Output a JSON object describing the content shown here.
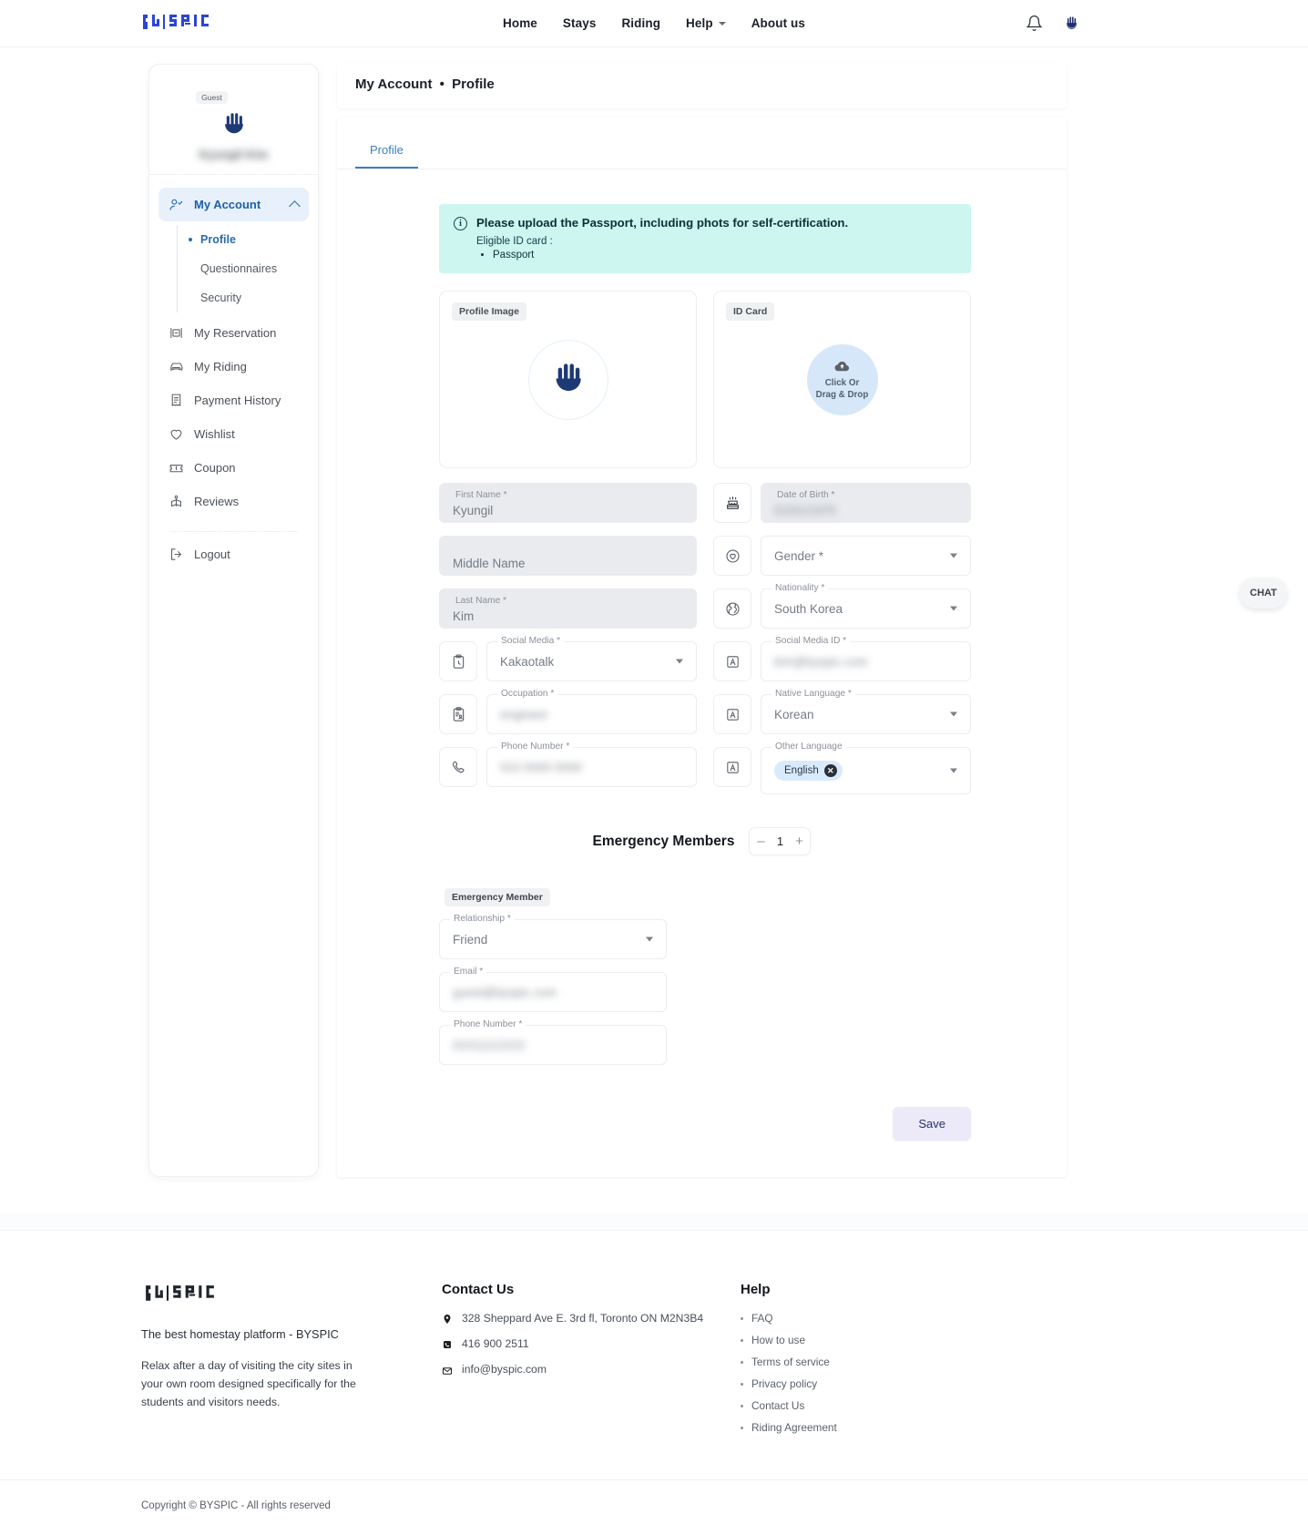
{
  "header": {
    "logo_text": "BYSPIC",
    "nav": [
      {
        "label": "Home",
        "has_caret": false
      },
      {
        "label": "Stays",
        "has_caret": false
      },
      {
        "label": "Riding",
        "has_caret": false
      },
      {
        "label": "Help",
        "has_caret": true
      },
      {
        "label": "About us",
        "has_caret": false
      }
    ],
    "bell_icon": "bell-icon",
    "user_icon": "user-hand-icon"
  },
  "sidebar": {
    "badge": "Guest",
    "user_name": "Kyungil Kim",
    "account": {
      "label": "My Account",
      "expanded": true,
      "children": [
        {
          "label": "Profile",
          "active": true
        },
        {
          "label": "Questionnaires",
          "active": false
        },
        {
          "label": "Security",
          "active": false
        }
      ]
    },
    "items": [
      {
        "label": "My Reservation",
        "icon": "reservation-icon"
      },
      {
        "label": "My Riding",
        "icon": "car-icon"
      },
      {
        "label": "Payment History",
        "icon": "receipt-icon"
      },
      {
        "label": "Wishlist",
        "icon": "heart-icon"
      },
      {
        "label": "Coupon",
        "icon": "ticket-icon"
      },
      {
        "label": "Reviews",
        "icon": "book-icon"
      }
    ],
    "logout": {
      "label": "Logout",
      "icon": "logout-icon"
    }
  },
  "breadcrumb": {
    "parent": "My Account",
    "separator": "•",
    "current": "Profile"
  },
  "tabs": [
    {
      "label": "Profile",
      "active": true
    }
  ],
  "notice": {
    "title": "Please upload the Passport, including phots for self-certification.",
    "subtitle": "Eligible ID card :",
    "items": [
      "Passport"
    ],
    "accent": "#ccf6ef"
  },
  "uploads": {
    "profile_image": {
      "chip": "Profile Image",
      "icon": "hand-logo-icon"
    },
    "id_card": {
      "chip": "ID Card",
      "drop_line1": "Click Or",
      "drop_line2": "Drag & Drop",
      "icon": "cloud-upload-icon"
    }
  },
  "form": {
    "left": [
      {
        "name": "first-name",
        "label": "First Name *",
        "value": "Kyungil",
        "style": "filled",
        "blur": false,
        "icon": null,
        "dropdown": false
      },
      {
        "name": "middle-name",
        "label": "",
        "placeholder": "Middle Name",
        "value": "",
        "style": "filled",
        "blur": false,
        "icon": null,
        "dropdown": false
      },
      {
        "name": "last-name",
        "label": "Last Name *",
        "value": "Kim",
        "style": "filled",
        "blur": false,
        "icon": null,
        "dropdown": false
      },
      {
        "name": "social-media",
        "label": "Social Media *",
        "value": "Kakaotalk",
        "style": "outlined",
        "blur": false,
        "icon": "clipboard-clock-icon",
        "dropdown": true
      },
      {
        "name": "occupation",
        "label": "Occupation *",
        "value": "engineer",
        "style": "outlined",
        "blur": true,
        "icon": "clipboard-person-icon",
        "dropdown": false
      },
      {
        "name": "phone-number",
        "label": "Phone Number *",
        "value": "010 0000 0000",
        "style": "outlined",
        "blur": true,
        "icon": "phone-icon",
        "dropdown": false
      }
    ],
    "right": [
      {
        "name": "date-of-birth",
        "label": "Date of Birth *",
        "value": "01/01/1970",
        "style": "filled",
        "blur": true,
        "icon": "cake-icon",
        "dropdown": false
      },
      {
        "name": "gender",
        "label": "",
        "placeholder": "Gender *",
        "value": "",
        "style": "outlined",
        "blur": false,
        "icon": "heart-circle-icon",
        "dropdown": true
      },
      {
        "name": "nationality",
        "label": "Nationality *",
        "value": "South Korea",
        "style": "outlined",
        "blur": false,
        "icon": "globe-icon",
        "dropdown": true
      },
      {
        "name": "social-media-id",
        "label": "Social Media ID *",
        "value": "kim@byspic.com",
        "style": "outlined",
        "blur": true,
        "icon": "language-icon",
        "dropdown": false
      },
      {
        "name": "native-language",
        "label": "Native Language *",
        "value": "Korean",
        "style": "outlined",
        "blur": false,
        "icon": "language-icon",
        "dropdown": true
      },
      {
        "name": "other-language",
        "label": "Other Language",
        "value": "",
        "chip": "English",
        "style": "outlined",
        "blur": false,
        "icon": "language-icon",
        "dropdown": true
      }
    ]
  },
  "emergency": {
    "title": "Emergency Members",
    "count": "1",
    "minus": "–",
    "plus": "+",
    "card_chip": "Emergency Member",
    "fields": [
      {
        "name": "relationship",
        "label": "Relationship *",
        "value": "Friend",
        "blur": false,
        "dropdown": true
      },
      {
        "name": "email",
        "label": "Email *",
        "value": "guest@byspic.com",
        "blur": true,
        "dropdown": false
      },
      {
        "name": "phone-number",
        "label": "Phone Number *",
        "value": "01011112222",
        "blur": true,
        "dropdown": false
      }
    ]
  },
  "save_button": {
    "label": "Save"
  },
  "chat": {
    "label": "CHAT"
  },
  "footer": {
    "logo_text": "BYSPIC",
    "tagline": "The best homestay platform - BYSPIC",
    "body": "Relax after a day of visiting the city sites in your own room designed specifically for the students and visitors needs.",
    "contact": {
      "heading": "Contact Us",
      "address": "328 Sheppard Ave E. 3rd fl, Toronto ON M2N3B4",
      "phone": "416 900 2511",
      "email": "info@byspic.com"
    },
    "help": {
      "heading": "Help",
      "links": [
        "FAQ",
        "How to use",
        "Terms of service",
        "Privacy policy",
        "Contact Us",
        "Riding Agreement"
      ]
    },
    "copyright": "Copyright © BYSPIC - All rights reserved"
  }
}
